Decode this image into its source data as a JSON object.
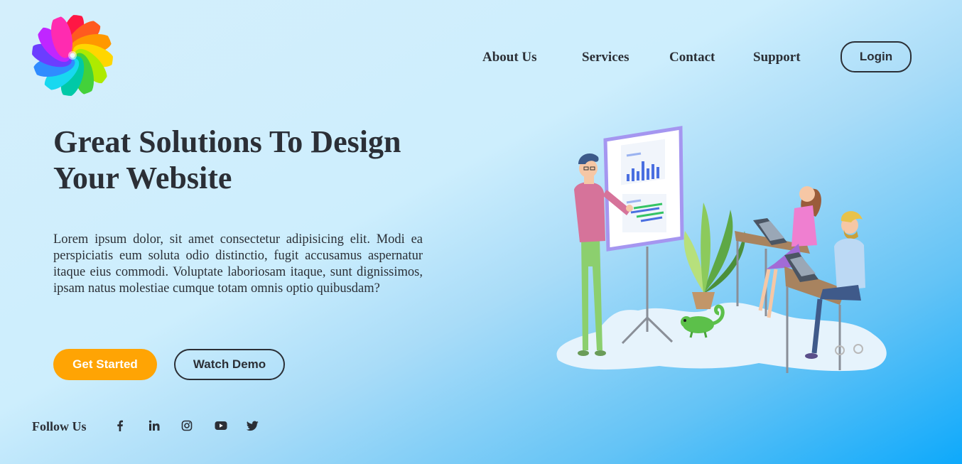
{
  "brand": {
    "logo_icon": "pinwheel-logo-icon"
  },
  "nav": {
    "links": [
      "About Us",
      "Services",
      "Contact",
      "Support"
    ],
    "login_label": "Login"
  },
  "hero": {
    "title": "Great Solutions To Design Your Website",
    "description": "Lorem ipsum dolor, sit amet consectetur adipisicing elit. Modi ea perspiciatis eum soluta odio distinctio, fugit accusamus aspernatur itaque eius commodi. Voluptate laboriosam itaque, sunt dignissimos, ipsam natus molestiae cumque totam omnis optio quibusdam?",
    "primary_button": "Get Started",
    "secondary_button": "Watch Demo",
    "illustration_icon": "team-meeting-illustration-icon"
  },
  "social": {
    "label": "Follow Us",
    "icons": [
      "facebook-icon",
      "linkedin-icon",
      "instagram-icon",
      "youtube-icon",
      "twitter-icon"
    ]
  },
  "colors": {
    "text": "#2b2f36",
    "accent": "#ffa404",
    "background_light": "#d4effc",
    "background_dark": "#0ea9fb"
  }
}
